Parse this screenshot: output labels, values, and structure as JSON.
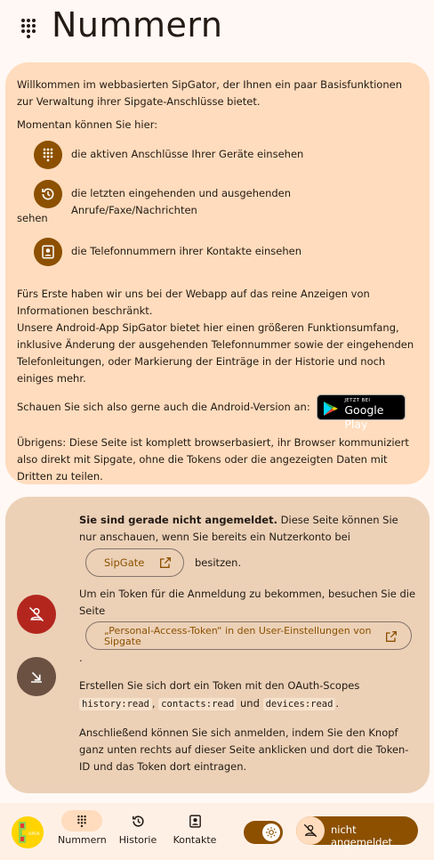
{
  "header": {
    "title": "Nummern"
  },
  "info": {
    "intro": "Willkommen im webbasierten SipGator, der Ihnen ein paar Basisfunktionen zur Verwaltung ihrer Sipgate-Anschlüsse bietet.",
    "can_heading": "Momentan können Sie hier:",
    "features": [
      {
        "icon": "dialpad-icon",
        "text": "die aktiven Anschlüsse Ihrer Geräte einsehen"
      },
      {
        "icon": "history-icon",
        "text": "die letzten eingehenden und ausgehenden Anrufe/Faxe/Nachrichten"
      },
      {
        "icon": "contacts-icon",
        "text": "die Telefonnummern ihrer Kontakte einsehen"
      }
    ],
    "feature2_suffix": "sehen",
    "webapp_line1": "Fürs Erste haben wir uns bei der Webapp auf das reine Anzeigen von Informationen beschränkt.",
    "webapp_line2": "Unsere Android-App SipGator bietet hier einen größeren Funktionsumfang, inklusive Änderung der ausgehenden Telefonnummer sowie der eingehenden Telefonleitungen, oder Markierung der Einträge in der Historie und noch einiges mehr.",
    "android_prompt": "Schauen Sie sich also gerne auch die Android-Version an:",
    "gplay_small": "JETZT BEI",
    "gplay_big": "Google Play",
    "privacy": "Übrigens: Diese Seite ist komplett browserbasiert, ihr Browser kommuniziert also direkt mit Sipgate, ohne die Tokens oder die angezeigten Daten mit Dritten zu teilen."
  },
  "login": {
    "not_logged_bold": "Sie sind gerade nicht angemeldet.",
    "not_logged_rest": " Diese Seite können Sie nur anschauen, wenn Sie bereits ein Nutzerkonto bei",
    "sipgate_link": "SipGate",
    "besitzen": "besitzen.",
    "token_intro": "Um ein Token für die Anmeldung zu bekommen, besuchen Sie die Seite",
    "pat_link": "„Personal-Access-Token“ in den User-Einstellungen von Sipgate",
    "dot": ".",
    "scopes_intro": "Erstellen Sie sich dort ein Token mit den OAuth-Scopes",
    "scope1": "history:read",
    "comma": ",",
    "scope2": "contacts:read",
    "und": "und",
    "scope3": "devices:read",
    "final": "Anschließend können Sie sich anmelden, indem Sie den Knopf ganz unten rechts auf dieser Seite anklicken und dort die Token-ID und das Token dort eintragen."
  },
  "bottom_nav": {
    "logo_text": "OPEN",
    "items": [
      {
        "label": "Nummern",
        "icon": "dialpad-icon",
        "active": true
      },
      {
        "label": "Historie",
        "icon": "history-icon"
      },
      {
        "label": "Kontakte",
        "icon": "contacts-icon"
      }
    ],
    "login_label": "nicht angemeldet"
  },
  "colors": {
    "accent": "#8c5000",
    "card_info": "#ffdcbd",
    "card_login": "#ecd1b7",
    "error": "#b3261e"
  }
}
